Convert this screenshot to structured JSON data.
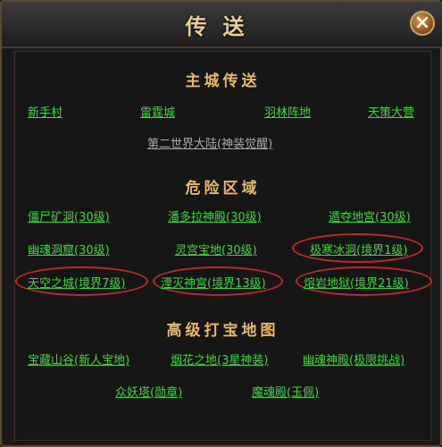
{
  "window": {
    "title": "传送"
  },
  "main_city": {
    "heading": "主城传送",
    "links": [
      "新手村",
      "雷霆城",
      "羽林阵地",
      "天策大营"
    ],
    "second_world": "第二世界大陆(神装觉醒)"
  },
  "danger_zone": {
    "heading": "危险区域",
    "links": [
      "僵尸矿洞(30级)",
      "潘多拉神殿(30级)",
      "遁夺地宫(30级)",
      "幽魂洞窟(30级)",
      "灵宫宝地(30级)",
      "极寒冰洞(境界1级)",
      "天空之城(境界7级)",
      "湮灭神宫(境界13级)",
      "熔岩地狱(境界21级)"
    ]
  },
  "treasure_maps": {
    "heading": "高级打宝地图",
    "links": [
      "宝藏山谷(新人宝地)",
      "烟花之地(3星神装)",
      "幽魂神殿(极限挑战)",
      "众妖塔(勋章)",
      "魔魂殿(玉佩)"
    ]
  },
  "colors": {
    "link": "#3ed43e",
    "heading": "#e8b86a",
    "highlight_ring": "#c6262a"
  },
  "icons": {
    "close": "close-icon"
  }
}
